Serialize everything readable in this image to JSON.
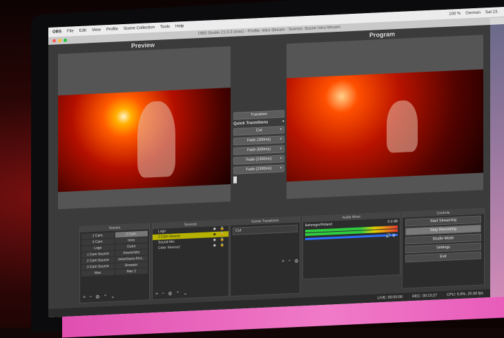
{
  "menubar": {
    "app": "OBS",
    "items": [
      "File",
      "Edit",
      "View",
      "Profile",
      "Scene Collection",
      "Tools",
      "Help"
    ],
    "status": [
      "100 %",
      "German",
      "Sat 23."
    ]
  },
  "window_title": "OBS Studio 21.0.3 (mac) - Profile: Intro-Stream - Scenes: Scene Intro-Wroom",
  "preview_label": "Preview",
  "program_label": "Program",
  "transitions": {
    "transition_button": "Transition",
    "quick_label": "Quick Transitions",
    "items": [
      "Cut",
      "Fade (300ms)",
      "Fade (600ms)",
      "Fade (1300ms)",
      "Fade (2300ms)"
    ]
  },
  "docks": {
    "scenes_title": "Scenes",
    "sources_title": "Sources",
    "scene_transitions_title": "Scene Transitions",
    "mixer_title": "Audio Mixer",
    "controls_title": "Controls"
  },
  "scenes": [
    [
      "1 Cam.",
      "2 Cam."
    ],
    [
      "3 Cam.",
      "Intro"
    ],
    [
      "Logo",
      "Outro"
    ],
    [
      "1 Cam Source",
      "Sound-Mix"
    ],
    [
      "2 Cam Source",
      "Intro/Outro-Pict..."
    ],
    [
      "3 Cam Source",
      "Browser"
    ],
    [
      "Mac",
      "Mac 2"
    ]
  ],
  "sources": [
    "Logo",
    "2 Cam Source",
    "Sound-Mix",
    "Color Source2"
  ],
  "scene_transition_value": "Cut",
  "mixer": {
    "source": "Behringer/Roland",
    "db": "0.0 dB"
  },
  "controls": [
    "Start Streaming",
    "Stop Recording",
    "Studio Mode",
    "Settings",
    "Exit"
  ],
  "statusbar": {
    "live": "LIVE: 00:00:00",
    "rec": "REC: 00:13:27",
    "cpu": "CPU: 5.0%, 25.00 fps"
  },
  "colors": {
    "accent_source": "#b7b100",
    "meter_green": "#2ecc40",
    "fader_blue": "#2d6fff"
  }
}
